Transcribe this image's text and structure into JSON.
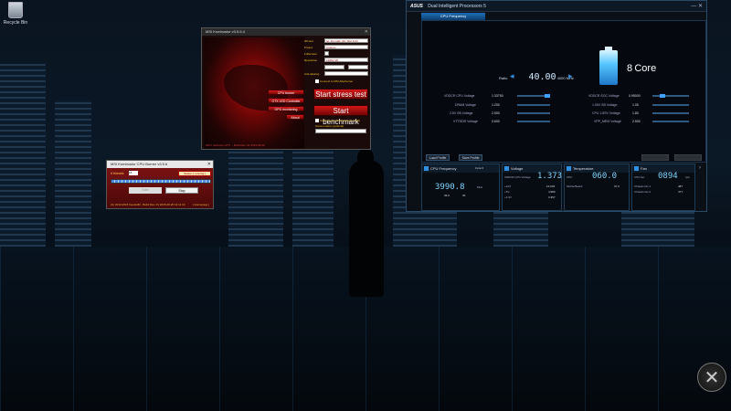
{
  "desktop": {
    "recycle_bin_label": "Recycle Bin"
  },
  "kombustor": {
    "title": "MSI Kombustor v3.5.6.4",
    "fields": [
      {
        "label": "3D test:",
        "value": "GL Furmark (1K-Test 4x0)"
      },
      {
        "label": "Preset:",
        "value": "Custom"
      },
      {
        "label": "Fullscreen",
        "value": ""
      },
      {
        "label": "Resolution",
        "value": "1280x720"
      },
      {
        "label": "",
        "value": ""
      },
      {
        "label": "Anti-aliasing",
        "value": ""
      }
    ],
    "link_afterburner": "Connect to MSI Afterburner",
    "buttons": [
      "CPU burner",
      "GTX LED Controller",
      "GPU monitoring",
      "About"
    ],
    "start_stress": "Start stress test",
    "start_benchmark": "Start benchmark",
    "submit_score": "Submit score (Performance only)",
    "screen_name": "Screen name (optional)",
    "status": "GPU: GeForce GTX ... Build Rev. 01 2015-08-20"
  },
  "burner": {
    "title": "MSI Kombustor CPU Burner v3.5.6",
    "threads_label": "# threads",
    "threads_value": "16",
    "status": "Status: [ running ]",
    "progress": 1.0,
    "start_label": "Start",
    "stop_label": "Stop",
    "footer": "(C) 2013-2015 Geeks3D - Build Rev. 01 2015-08-20 14:11:13",
    "home_link": "[ Homepage ]"
  },
  "asus": {
    "brand": "ASUS",
    "title": "Dual Intelligent Processors 5",
    "tab": "CPU Frequency",
    "ratio_label": "Ratio",
    "ratio_value": "40.00",
    "ratio_unit": "4000 MHz",
    "core_count": "8",
    "core_label": "Core",
    "voltages_left": [
      {
        "label": "VDDCR CPU Voltage",
        "value": "1.33750"
      },
      {
        "label": "DRAM Voltage",
        "value": "1.200"
      },
      {
        "label": "2.5V SB Voltage",
        "value": "2.500"
      },
      {
        "label": "VTTDDR Voltage",
        "value": "0.600"
      }
    ],
    "voltages_right": [
      {
        "label": "VDDCR SOC Voltage",
        "value": "0.95000"
      },
      {
        "label": "1.05V SB Voltage",
        "value": "1.05"
      },
      {
        "label": "CPU 1.8SV Voltage",
        "value": "1.80"
      },
      {
        "label": "VPP_MEM Voltage",
        "value": "2.500"
      }
    ],
    "load_profile": "Load Profile",
    "save_profile": "Save Profile",
    "modules": {
      "cpu_freq": {
        "title": "CPU Frequency",
        "selector": "Core 0",
        "value": "3990.8",
        "unit": "MHz",
        "sub1": "39.9",
        "sub2": "40"
      },
      "voltage": {
        "title": "Voltage",
        "main_label": "VDDCR CPU Voltage",
        "main_value": "1.373",
        "main_unit": "V",
        "rows": [
          {
            "label": "+12V",
            "value": "12.033"
          },
          {
            "label": "+5V",
            "value": "4.980"
          },
          {
            "label": "+3.3V",
            "value": "3.357"
          }
        ]
      },
      "temperature": {
        "title": "Temperature",
        "cpu_label": "CPU",
        "cpu_value": "060.0",
        "mb_label": "MotherBoard",
        "mb_value": "37.0"
      },
      "fan": {
        "title": "Fan",
        "cpu_label": "CPU fan",
        "cpu_value": "0894",
        "unit": "rpm",
        "rows": [
          {
            "label": "Chassis fan 1",
            "value": "487"
          },
          {
            "label": "Chassis fan 2",
            "value": "477"
          }
        ]
      }
    }
  },
  "colors": {
    "msi_red": "#c01010",
    "asus_blue": "#2f8fe0",
    "cyan": "#7fd4ff"
  }
}
